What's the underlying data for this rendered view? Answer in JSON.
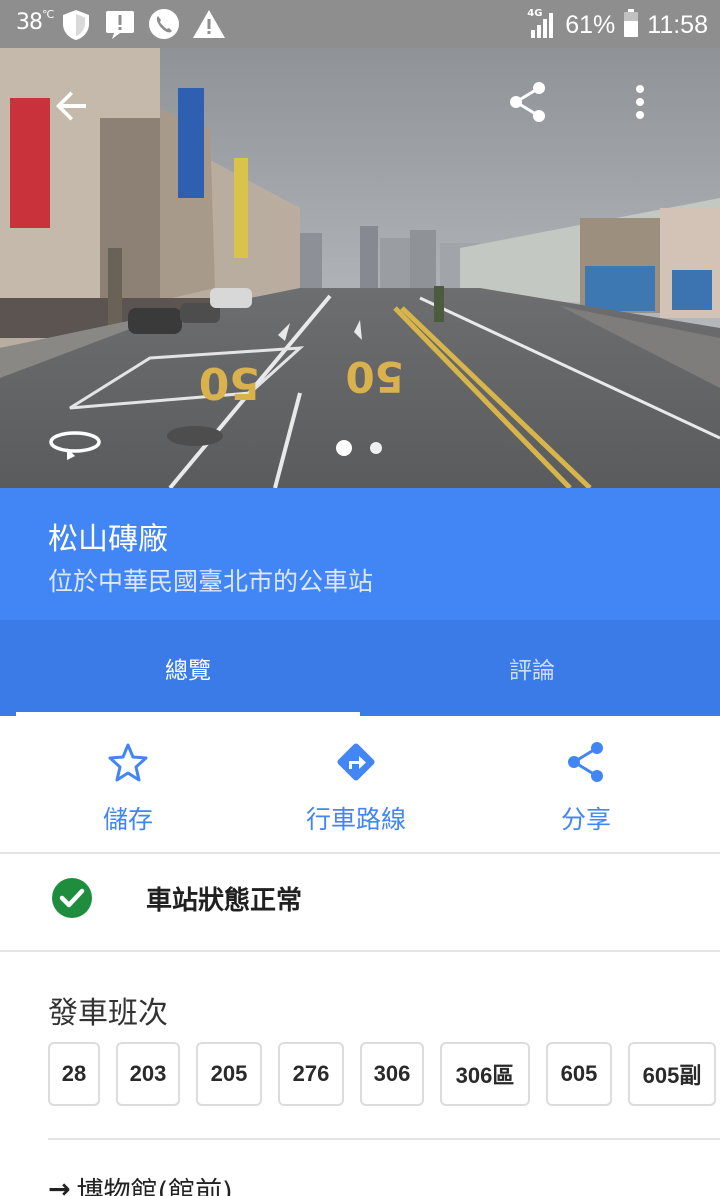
{
  "status_bar": {
    "temperature": "38",
    "temperature_unit": "°C",
    "network": "4G",
    "battery": "61%",
    "time": "11:58",
    "icons": [
      "shield-icon",
      "alert-box-icon",
      "phone-icon",
      "warning-icon",
      "signal-icon",
      "battery-icon"
    ]
  },
  "hero": {
    "page_indicator": {
      "count": 2,
      "active": 1
    },
    "road_marking": "50",
    "icons": [
      "back-arrow-icon",
      "share-icon",
      "more-vert-icon",
      "rotate-360-icon"
    ]
  },
  "place": {
    "name": "松山磚廠",
    "description": "位於中華民國臺北市的公車站"
  },
  "tabs": [
    {
      "label": "總覽",
      "active": true
    },
    {
      "label": "評論",
      "active": false
    }
  ],
  "actions": [
    {
      "label": "儲存",
      "icon": "star-outline-icon"
    },
    {
      "label": "行車路線",
      "icon": "directions-icon"
    },
    {
      "label": "分享",
      "icon": "share-icon"
    }
  ],
  "station_status": "車站狀態正常",
  "departures": {
    "title": "發車班次",
    "routes": [
      "28",
      "203",
      "205",
      "276",
      "306",
      "306區",
      "605",
      "605副"
    ]
  },
  "destination": {
    "arrow": "→",
    "name": "博物館(館前)"
  },
  "colors": {
    "header_blue": "#4285f4",
    "tab_blue": "#3b7be8",
    "status_green": "#1e8e3e",
    "status_bar_gray": "#8e8e8e"
  }
}
